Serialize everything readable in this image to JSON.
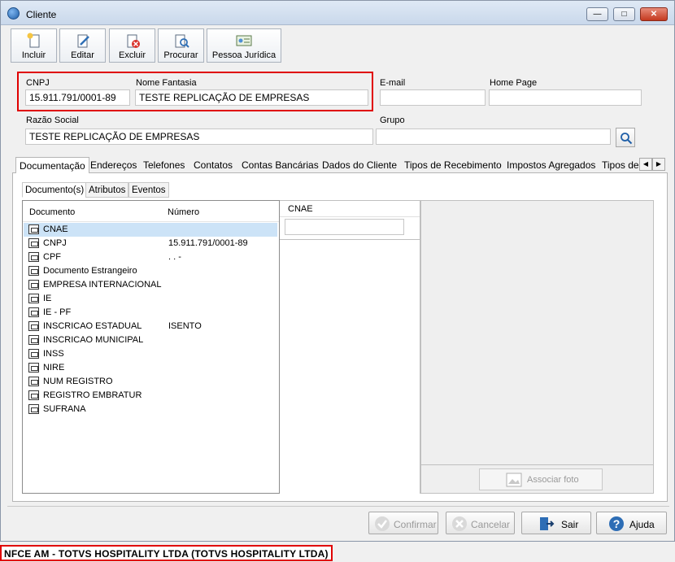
{
  "window": {
    "title": "Cliente"
  },
  "toolbar": {
    "incluir": "Incluir",
    "editar": "Editar",
    "excluir": "Excluir",
    "procurar": "Procurar",
    "pessoa_juridica": "Pessoa Jurídica"
  },
  "form": {
    "cnpj_label": "CNPJ",
    "cnpj_value": "15.911.791/0001-89",
    "nome_fantasia_label": "Nome Fantasia",
    "nome_fantasia_value": "TESTE REPLICAÇÃO DE EMPRESAS",
    "email_label": "E-mail",
    "email_value": "",
    "home_page_label": "Home Page",
    "home_page_value": "",
    "razao_social_label": "Razão Social",
    "razao_social_value": "TESTE REPLICAÇÃO DE EMPRESAS",
    "grupo_label": "Grupo",
    "grupo_value": ""
  },
  "tabs": [
    "Documentação",
    "Endereços",
    "Telefones",
    "Contatos",
    "Contas Bancárias",
    "Dados do Cliente",
    "Tipos de Recebimento",
    "Impostos Agregados",
    "Tipos de"
  ],
  "subtabs": [
    "Documento(s)",
    "Atributos",
    "Eventos"
  ],
  "documents": {
    "col_documento": "Documento",
    "col_numero": "Número",
    "rows": [
      {
        "name": "CNAE",
        "number": ""
      },
      {
        "name": "CNPJ",
        "number": "15.911.791/0001-89"
      },
      {
        "name": "CPF",
        "number": ". . -"
      },
      {
        "name": "Documento Estrangeiro",
        "number": ""
      },
      {
        "name": "EMPRESA INTERNACIONAL",
        "number": ""
      },
      {
        "name": "IE",
        "number": ""
      },
      {
        "name": "IE - PF",
        "number": ""
      },
      {
        "name": "INSCRICAO ESTADUAL",
        "number": "ISENTO"
      },
      {
        "name": "INSCRICAO MUNICIPAL",
        "number": ""
      },
      {
        "name": "INSS",
        "number": ""
      },
      {
        "name": "NIRE",
        "number": ""
      },
      {
        "name": "NUM REGISTRO",
        "number": ""
      },
      {
        "name": "REGISTRO EMBRATUR",
        "number": ""
      },
      {
        "name": "SUFRANA",
        "number": ""
      }
    ]
  },
  "cnae": {
    "label": "CNAE",
    "value": ""
  },
  "photo": {
    "associar_foto": "Associar foto"
  },
  "buttons": {
    "confirmar": "Confirmar",
    "cancelar": "Cancelar",
    "sair": "Sair",
    "ajuda": "Ajuda"
  },
  "status": {
    "text": "NFCE AM - TOTVS HOSPITALITY LTDA (TOTVS HOSPITALITY LTDA)"
  },
  "colors": {
    "highlight_red": "#e00000",
    "selection": "#cce3f7"
  }
}
